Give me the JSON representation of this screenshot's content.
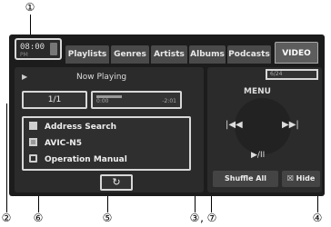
{
  "callouts": [
    "①",
    "②",
    "③",
    "④",
    "⑤",
    "⑥",
    "⑦"
  ],
  "callout_separator": ",",
  "clock": {
    "time": "08:00",
    "subtext": "PM"
  },
  "tabs": [
    {
      "label": "Playlists",
      "active": false
    },
    {
      "label": "Genres",
      "active": false
    },
    {
      "label": "Artists",
      "active": false
    },
    {
      "label": "Albums",
      "active": false
    },
    {
      "label": "Podcasts",
      "active": false
    },
    {
      "label": "VIDEO",
      "active": true
    }
  ],
  "now_playing": {
    "icon": "play-triangle-icon",
    "label": "Now Playing"
  },
  "track_count": "1/1",
  "time": {
    "elapsed": "0:00",
    "remaining": "-2:01"
  },
  "list": [
    {
      "icon": "book-icon",
      "label": "Address Search"
    },
    {
      "icon": "doc-icon",
      "label": "AVIC-N5"
    },
    {
      "icon": "disc-icon",
      "label": "Operation Manual"
    }
  ],
  "repeat_icon": "↻",
  "battery_status": "6/24",
  "controls": {
    "menu": "MENU",
    "prev": "|◀◀",
    "next": "▶▶|",
    "play_pause": "▶/II"
  },
  "buttons": {
    "shuffle": "Shuffle All",
    "hide": "☒ Hide"
  }
}
